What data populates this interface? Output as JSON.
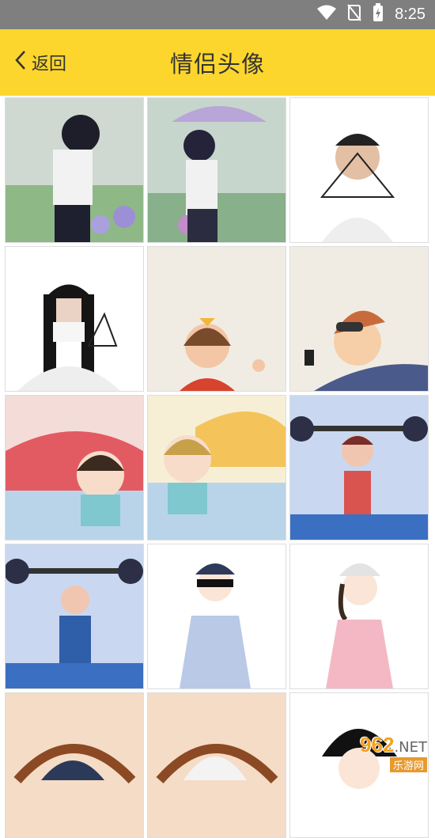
{
  "status": {
    "time": "8:25"
  },
  "header": {
    "back_label": "返回",
    "title": "情侣头像"
  },
  "images": [
    {
      "icon": "anime-boy-rain"
    },
    {
      "icon": "anime-girl-umbrella"
    },
    {
      "icon": "photo-man-triangle"
    },
    {
      "icon": "photo-woman-triangle"
    },
    {
      "icon": "cartoon-girl-bow"
    },
    {
      "icon": "cartoon-boy-phone"
    },
    {
      "icon": "anime-girl-kid"
    },
    {
      "icon": "anime-boy-kid"
    },
    {
      "icon": "weightlift-girl"
    },
    {
      "icon": "weightlift-man"
    },
    {
      "icon": "cartoon-boy-cap"
    },
    {
      "icon": "cartoon-girl-peace"
    },
    {
      "icon": "straw-hat-1"
    },
    {
      "icon": "straw-hat-2"
    },
    {
      "icon": "cartoon-boy-bowl"
    }
  ],
  "watermark": {
    "number": "962",
    "suffix": ".NET",
    "sub": "乐游网"
  }
}
